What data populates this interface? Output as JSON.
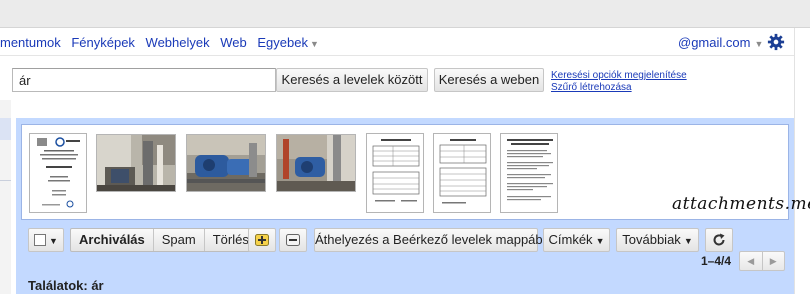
{
  "nav": {
    "links": [
      "mentumok",
      "Fényképek",
      "Webhelyek",
      "Web"
    ],
    "more_label": "Egyebek",
    "account": "@gmail.com"
  },
  "search": {
    "query": "ár",
    "search_mail_label": "Keresés a levelek között",
    "search_web_label": "Keresés a weben",
    "show_options_label": "Keresési opciók megjelenítése",
    "create_filter_label": "Szűrő létrehozása"
  },
  "attachments": {
    "brand": "attachments.me",
    "items": [
      {
        "kind": "document",
        "icon": "doc-with-logo"
      },
      {
        "kind": "photo",
        "icon": "photo-pump-room"
      },
      {
        "kind": "photo",
        "icon": "photo-blue-pump"
      },
      {
        "kind": "photo",
        "icon": "photo-pump-pipes"
      },
      {
        "kind": "document",
        "icon": "doc-form"
      },
      {
        "kind": "document",
        "icon": "doc-form"
      },
      {
        "kind": "document",
        "icon": "doc-text"
      }
    ]
  },
  "toolbar": {
    "archive_label": "Archiválás",
    "spam_label": "Spam",
    "delete_label": "Törlés",
    "move_label": "Áthelyezés a Beérkező levelek mappába",
    "labels_label": "Címkék",
    "more_label": "Továbbiak"
  },
  "pager": {
    "range": "1–4/4"
  },
  "results": {
    "label": "Találatok: ár"
  }
}
